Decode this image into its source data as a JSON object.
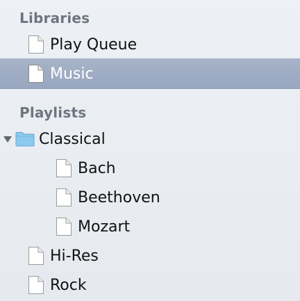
{
  "sidebar": {
    "sections": [
      {
        "header": "Libraries",
        "items": [
          {
            "label": "Play Queue",
            "icon": "document-icon",
            "selected": false
          },
          {
            "label": "Music",
            "icon": "document-icon",
            "selected": true
          }
        ]
      },
      {
        "header": "Playlists",
        "folder": {
          "label": "Classical",
          "icon": "folder-icon",
          "expanded": true,
          "children": [
            {
              "label": "Bach",
              "icon": "document-icon"
            },
            {
              "label": "Beethoven",
              "icon": "document-icon"
            },
            {
              "label": "Mozart",
              "icon": "document-icon"
            }
          ]
        },
        "items": [
          {
            "label": "Hi-Res",
            "icon": "document-icon"
          },
          {
            "label": "Rock",
            "icon": "document-icon"
          }
        ]
      }
    ]
  },
  "colors": {
    "selection": "#9eabc3",
    "header_text": "#6d7680",
    "folder_blue": "#7fc2ea"
  }
}
